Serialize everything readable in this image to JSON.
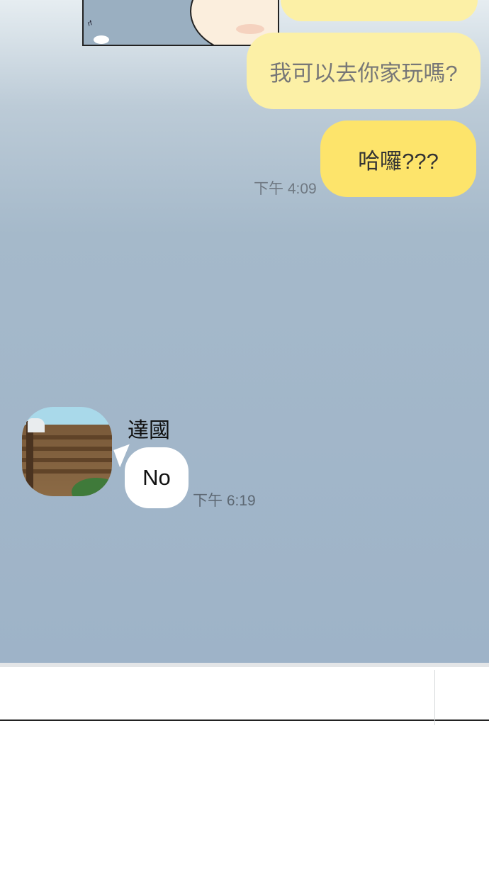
{
  "chat": {
    "messages_sent": [
      {
        "text": ""
      },
      {
        "text": "我可以去你家玩嗎?"
      },
      {
        "text": "哈囉???"
      }
    ],
    "sent_time": "下午 4:09",
    "received": {
      "sender_name": "達國",
      "text": "No",
      "time": "下午 6:19"
    }
  },
  "colors": {
    "sent_bubble": "#fcf0a6",
    "sent_bubble_latest": "#fde46b",
    "received_bubble": "#ffffff",
    "chat_background": "#9eb3c8"
  },
  "icons": {
    "avatar": "contact-avatar-photo"
  }
}
